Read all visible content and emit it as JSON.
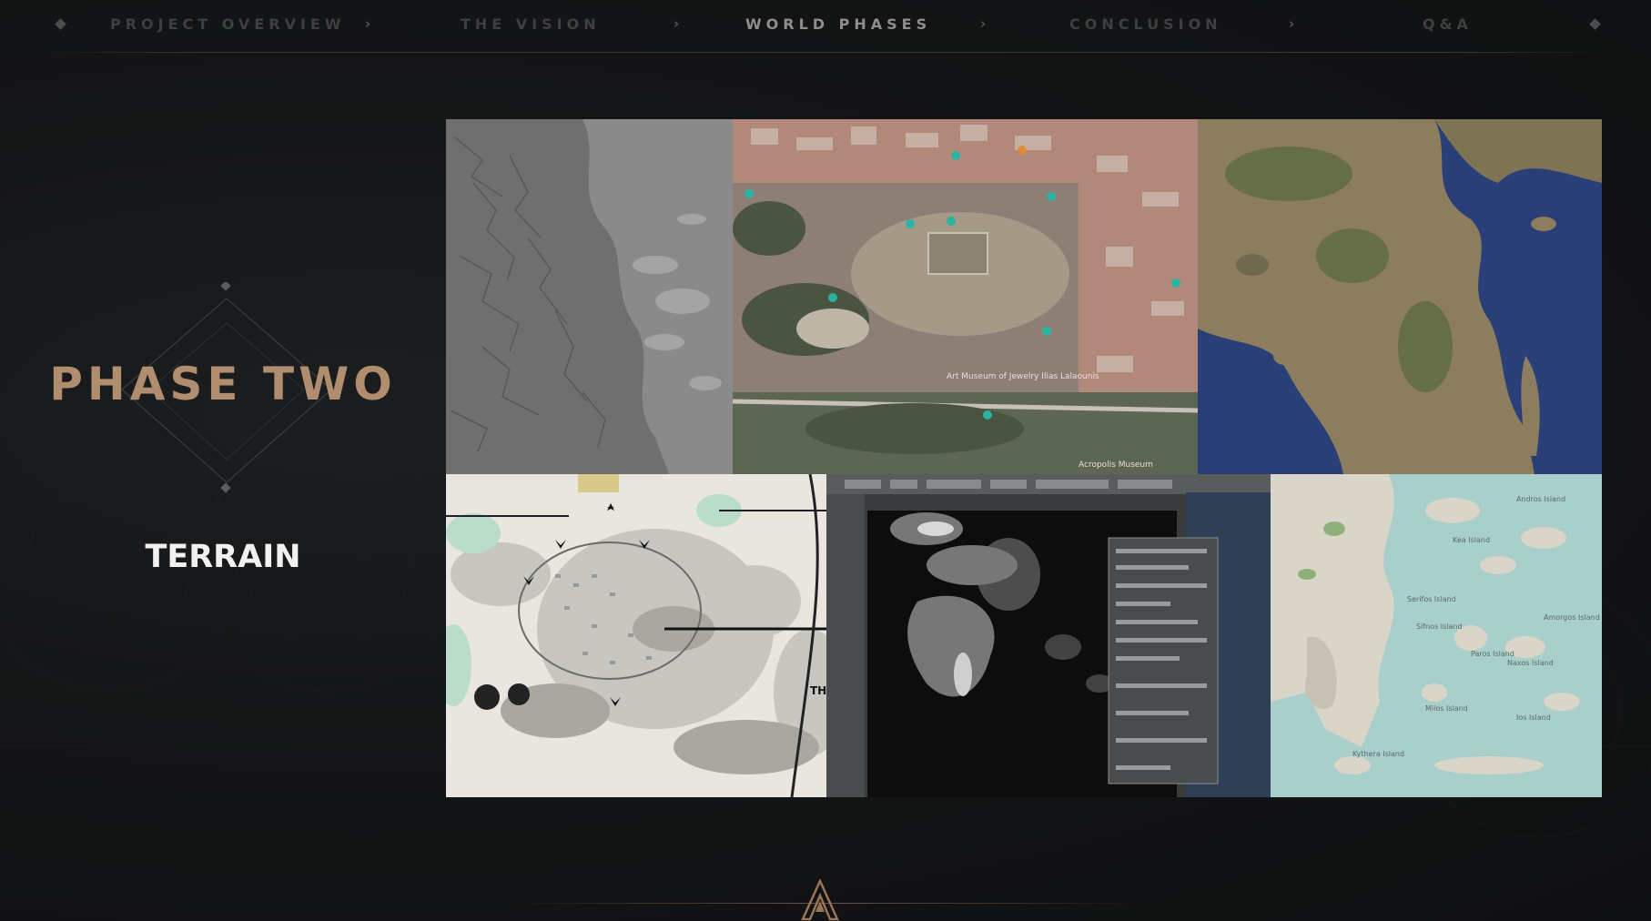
{
  "nav": {
    "items": [
      {
        "label": "PROJECT OVERVIEW",
        "active": false
      },
      {
        "label": "THE VISION",
        "active": false
      },
      {
        "label": "WORLD PHASES",
        "active": true
      },
      {
        "label": "CONCLUSION",
        "active": false
      },
      {
        "label": "Q&A",
        "active": false
      }
    ],
    "separator": "›"
  },
  "slide": {
    "title": "PHASE TWO",
    "subtitle": "TERRAIN"
  },
  "map_labels": {
    "museum": "Art Museum of Jewelry Ilias Lalaounis",
    "acropolis_museum": "Acropolis Museum",
    "hamlet_label": "TH",
    "islands": [
      "Kythera Island",
      "Milos Island",
      "Naxos Island",
      "Paros Island",
      "Ios Island",
      "Andros Island",
      "Kea Island",
      "Serifos Island",
      "Sifnos Island",
      "Amorgos Island"
    ]
  },
  "colors": {
    "accent": "#b08d6e",
    "nav_active": "#8e8e8e",
    "nav_inactive": "#3d3f41",
    "background": "#121314"
  }
}
